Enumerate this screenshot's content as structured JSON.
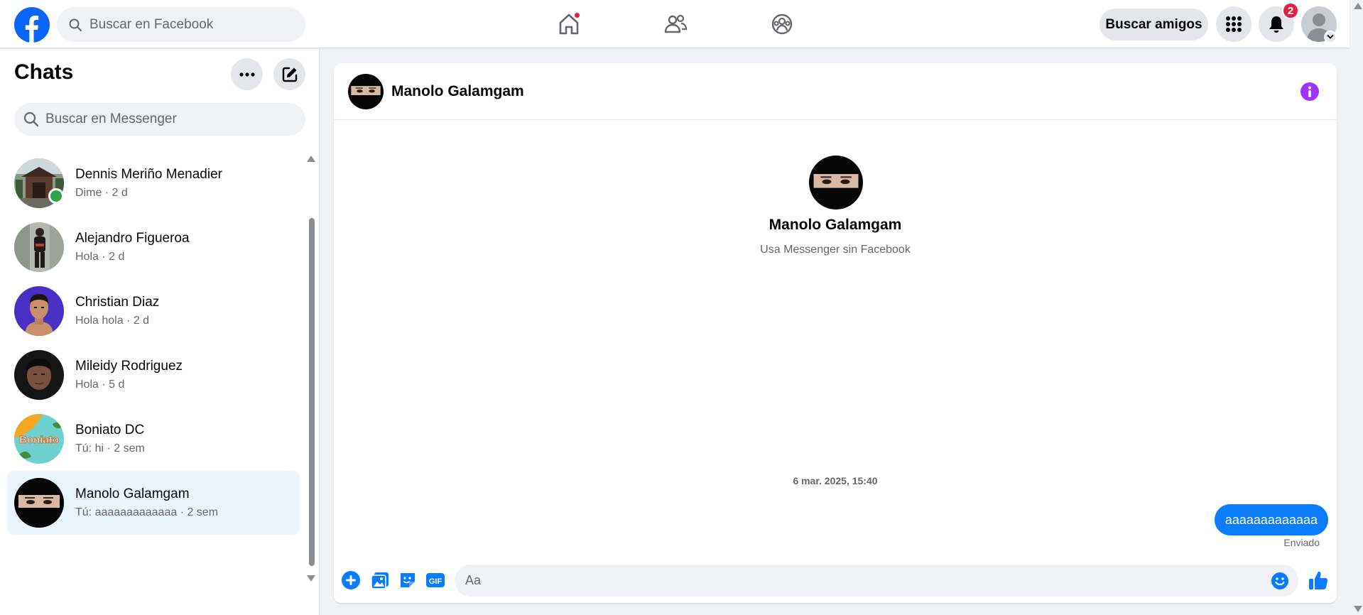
{
  "topbar": {
    "search_placeholder": "Buscar en Facebook",
    "find_friends_label": "Buscar amigos",
    "notifications_count": "2",
    "logo_icon": "facebook-logo",
    "brand_color": "#0866ff"
  },
  "sidebar": {
    "title": "Chats",
    "search_placeholder": "Buscar en Messenger",
    "chats": [
      {
        "name": "Dennis Meriño Menadier",
        "preview": "Dime · 2 d",
        "online": true,
        "avatar": "temple-photo",
        "active": false
      },
      {
        "name": "Alejandro Figueroa",
        "preview": "Hola · 2 d",
        "online": false,
        "avatar": "person-street-photo",
        "active": false
      },
      {
        "name": "Christian Diaz",
        "preview": "Hola hola · 2 d",
        "online": false,
        "avatar": "man-purple-bg-photo",
        "active": false
      },
      {
        "name": "Mileidy Rodriguez",
        "preview": "Hola · 5 d",
        "online": false,
        "avatar": "woman-dark-photo",
        "active": false
      },
      {
        "name": "Boniato DC",
        "preview": "Tú: hi · 2 sem",
        "online": false,
        "avatar": "boniato-logo",
        "active": false
      },
      {
        "name": "Manolo Galamgam",
        "preview": "Tú: aaaaaaaaaaaaa · 2 sem",
        "online": false,
        "avatar": "eyes-photo",
        "active": true
      }
    ]
  },
  "conversation": {
    "contact_name": "Manolo Galamgam",
    "intro_subtitle": "Usa Messenger sin Facebook",
    "timestamp": "6 mar. 2025, 15:40",
    "messages": [
      {
        "text": "aaaaaaaaaaaaa",
        "from_me": true,
        "status": "Enviado"
      }
    ],
    "composer_placeholder": "Aa",
    "accent_color": "#0a7cff",
    "info_color": "#a033ff"
  }
}
